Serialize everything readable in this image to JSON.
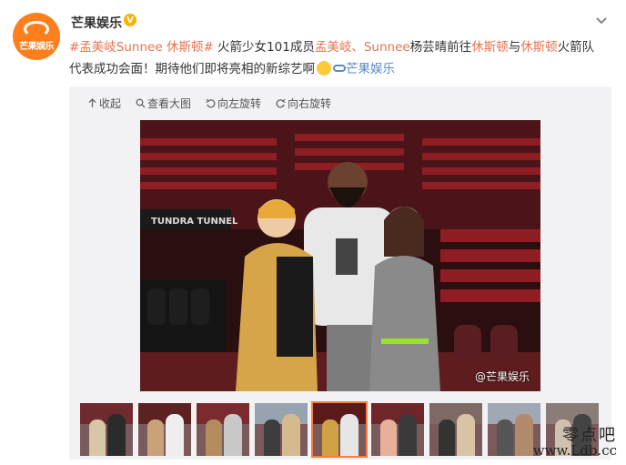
{
  "account": {
    "name": "芒果娱乐",
    "avatar_text": "芒果娱乐",
    "verified_icon": "verified-badge-icon"
  },
  "post": {
    "line1_tag": "#孟美岐Sunnee 休斯顿#",
    "line1_text1": " 火箭少女101成员",
    "line1_link1": "孟美岐",
    "line1_sep": "、",
    "line1_link2": "Sunnee",
    "line1_text2": "杨芸晴前往",
    "line1_link3": "休斯顿",
    "line1_text3": "与",
    "line1_link4": "休斯顿",
    "line1_text4": "火箭队",
    "line2_text": "代表成功会面！期待他们即将亮相的新综艺啊",
    "line2_link": "芒果娱乐"
  },
  "toolbar": {
    "collapse": "收起",
    "view_large": "查看大图",
    "rotate_left": "向左旋转",
    "rotate_right": "向右旋转"
  },
  "photo": {
    "watermark": "@芒果娱乐"
  },
  "thumbnails": {
    "count": 9,
    "active_index": 4
  },
  "site_watermark": {
    "name": "零点吧",
    "url": "www.Ldb.cc"
  },
  "colors": {
    "link": "#eb7350",
    "accent": "#ff7f1e",
    "thumb_active": "#fa7d3c",
    "media_bg": "#f2f2f5"
  }
}
